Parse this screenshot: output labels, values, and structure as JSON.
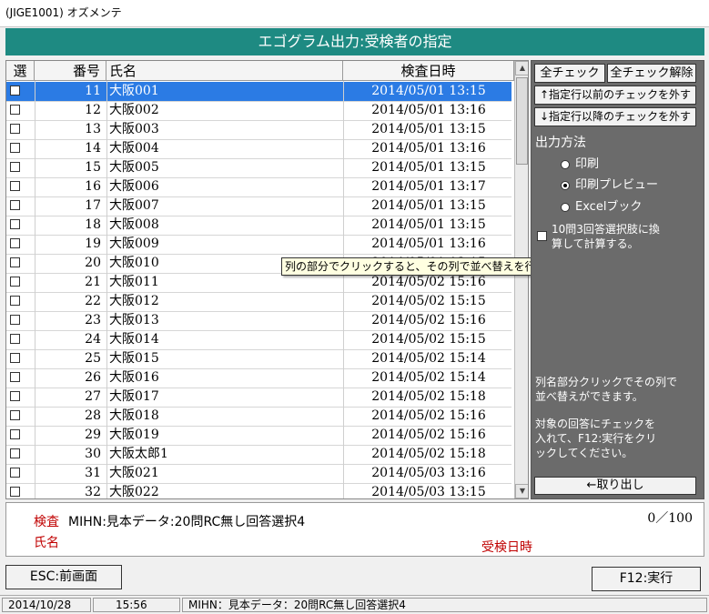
{
  "window": {
    "title": "(JIGE1001) オズメンテ"
  },
  "header": {
    "title": "エゴグラム出力:受検者の指定"
  },
  "table": {
    "columns": {
      "select": "選",
      "number": "番号",
      "name": "氏名",
      "date": "検査日時"
    },
    "rows": [
      {
        "number": "11",
        "name": "大阪001",
        "date": "2014/05/01 13:15",
        "selected": true
      },
      {
        "number": "12",
        "name": "大阪002",
        "date": "2014/05/01 13:16"
      },
      {
        "number": "13",
        "name": "大阪003",
        "date": "2014/05/01 13:15"
      },
      {
        "number": "14",
        "name": "大阪004",
        "date": "2014/05/01 13:16"
      },
      {
        "number": "15",
        "name": "大阪005",
        "date": "2014/05/01 13:15"
      },
      {
        "number": "16",
        "name": "大阪006",
        "date": "2014/05/01 13:17"
      },
      {
        "number": "17",
        "name": "大阪007",
        "date": "2014/05/01 13:15"
      },
      {
        "number": "18",
        "name": "大阪008",
        "date": "2014/05/01 13:15"
      },
      {
        "number": "19",
        "name": "大阪009",
        "date": "2014/05/01 13:16"
      },
      {
        "number": "20",
        "name": "大阪010",
        "date": "2014/05/01 13:15"
      },
      {
        "number": "21",
        "name": "大阪011",
        "date": "2014/05/02 15:16"
      },
      {
        "number": "22",
        "name": "大阪012",
        "date": "2014/05/02 15:15"
      },
      {
        "number": "23",
        "name": "大阪013",
        "date": "2014/05/02 15:16"
      },
      {
        "number": "24",
        "name": "大阪014",
        "date": "2014/05/02 15:15"
      },
      {
        "number": "25",
        "name": "大阪015",
        "date": "2014/05/02 15:14"
      },
      {
        "number": "26",
        "name": "大阪016",
        "date": "2014/05/02 15:14"
      },
      {
        "number": "27",
        "name": "大阪017",
        "date": "2014/05/02 15:18"
      },
      {
        "number": "28",
        "name": "大阪018",
        "date": "2014/05/02 15:16"
      },
      {
        "number": "29",
        "name": "大阪019",
        "date": "2014/05/02 15:16"
      },
      {
        "number": "30",
        "name": "大阪太郎1",
        "date": "2014/05/02 15:18"
      },
      {
        "number": "31",
        "name": "大阪021",
        "date": "2014/05/03 13:16"
      },
      {
        "number": "32",
        "name": "大阪022",
        "date": "2014/05/03 13:15"
      }
    ]
  },
  "tooltip": {
    "text": "列の部分でクリックすると、その列で並べ替えを行います。"
  },
  "right_panel": {
    "check_all": "全チェック",
    "uncheck_all": "全チェック解除",
    "uncheck_before": "↑指定行以前のチェックを外す",
    "uncheck_after": "↓指定行以降のチェックを外す",
    "output_method_label": "出力方法",
    "options": [
      {
        "label": "印刷",
        "checked": false
      },
      {
        "label": "印刷プレビュー",
        "checked": true
      },
      {
        "label": "Excelブック",
        "checked": false
      }
    ],
    "convert_check_line1": "10問3回答選択肢に換",
    "convert_check_line2": "算して計算する。",
    "help1_line1": "列名部分クリックでその列で",
    "help1_line2": "並べ替えができます。",
    "help2_line1": "対象の回答にチェックを",
    "help2_line2": "入れて、F12:実行をクリ",
    "help2_line3": "ックしてください。",
    "retrieve_button": "←取り出し"
  },
  "info": {
    "exam_label": "検査",
    "exam_value": "MIHN:見本データ:20問RC無し回答選択4",
    "name_label": "氏名",
    "count": "0／100",
    "date_label": "受検日時"
  },
  "footer": {
    "esc_button": "ESC:前画面",
    "f12_button": "F12:実行"
  },
  "statusbar": {
    "date": "2014/10/28",
    "time": "15:56",
    "info": "MIHN：見本データ：20問RC無し回答選択4"
  }
}
